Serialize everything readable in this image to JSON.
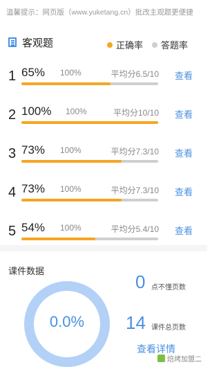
{
  "tip": "温馨提示：网页版（www.yuketang.cn）批改主观题更便捷",
  "objective": {
    "title": "客观题",
    "legend": [
      {
        "label": "正确率",
        "color": "#f5a623"
      },
      {
        "label": "答题率",
        "color": "#cfcfcf"
      }
    ],
    "questions": [
      {
        "num": "1",
        "correct_rate": "65%",
        "answer_rate": "100%",
        "avg": "平均分6.5/10",
        "view": "查看",
        "fill": 0.65
      },
      {
        "num": "2",
        "correct_rate": "100%",
        "answer_rate": "100%",
        "avg": "平均分10/10",
        "view": "查看",
        "fill": 1.0
      },
      {
        "num": "3",
        "correct_rate": "73%",
        "answer_rate": "100%",
        "avg": "平均分7.3/10",
        "view": "查看",
        "fill": 0.73
      },
      {
        "num": "4",
        "correct_rate": "73%",
        "answer_rate": "100%",
        "avg": "平均分7.3/10",
        "view": "查看",
        "fill": 0.73
      },
      {
        "num": "5",
        "correct_rate": "54%",
        "answer_rate": "100%",
        "avg": "平均分5.4/10",
        "view": "查看",
        "fill": 0.54
      }
    ]
  },
  "courseware": {
    "title": "课件数据",
    "rate": "0.0%",
    "rate_value": 0.0,
    "unknown_pages": {
      "value": "0",
      "label": "点不懂页数"
    },
    "total_pages": {
      "value": "14",
      "label": "课件总页数"
    },
    "detail": "查看详情"
  },
  "watermark": "焙烤加盟二",
  "colors": {
    "accent": "#4a90e2",
    "correct": "#f5a623",
    "answered": "#cfcfcf",
    "ring": "#b3d1f7"
  }
}
